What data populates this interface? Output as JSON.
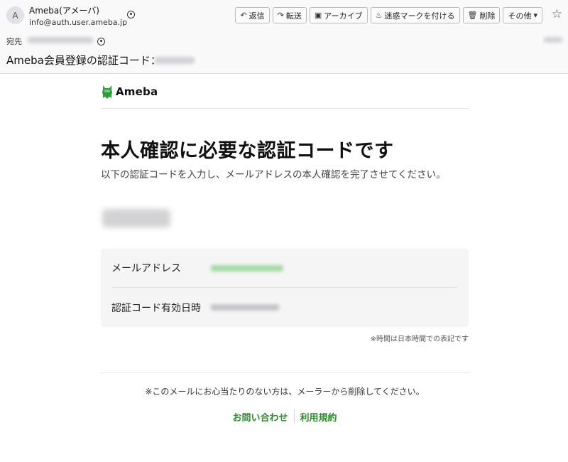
{
  "header": {
    "avatar_letter": "A",
    "sender_name": "Ameba(アメーバ)",
    "sender_address": "info@auth.user.ameba.jp",
    "to_label": "宛先",
    "subject": "Ameba会員登録の認証コード：",
    "toolbar": [
      {
        "label": "返信",
        "icon": "↶"
      },
      {
        "label": "転送",
        "icon": "↷"
      },
      {
        "label": "アーカイブ",
        "icon": "▣"
      },
      {
        "label": "迷惑マークを付ける",
        "icon": "♨"
      },
      {
        "label": "削除",
        "icon": "🗑"
      },
      {
        "label": "その他",
        "icon": "▾"
      }
    ],
    "star_icon": "☆"
  },
  "body": {
    "logo_text": "Ameba",
    "logo_color": "#2e9e3a",
    "headline": "本人確認に必要な認証コードです",
    "lead": "以下の認証コードを入力し、メールアドレスの本人確認を完了させてください。",
    "info": {
      "email_label": "メールアドレス",
      "expire_label": "認証コード有効日時"
    },
    "time_note": "※時間は日本時間での表記です",
    "footer_note": "※このメールにお心当たりのない方は、メーラーから削除してください。",
    "links": {
      "contact": "お問い合わせ",
      "terms": "利用規約"
    },
    "link_color": "#2e8b2e"
  }
}
